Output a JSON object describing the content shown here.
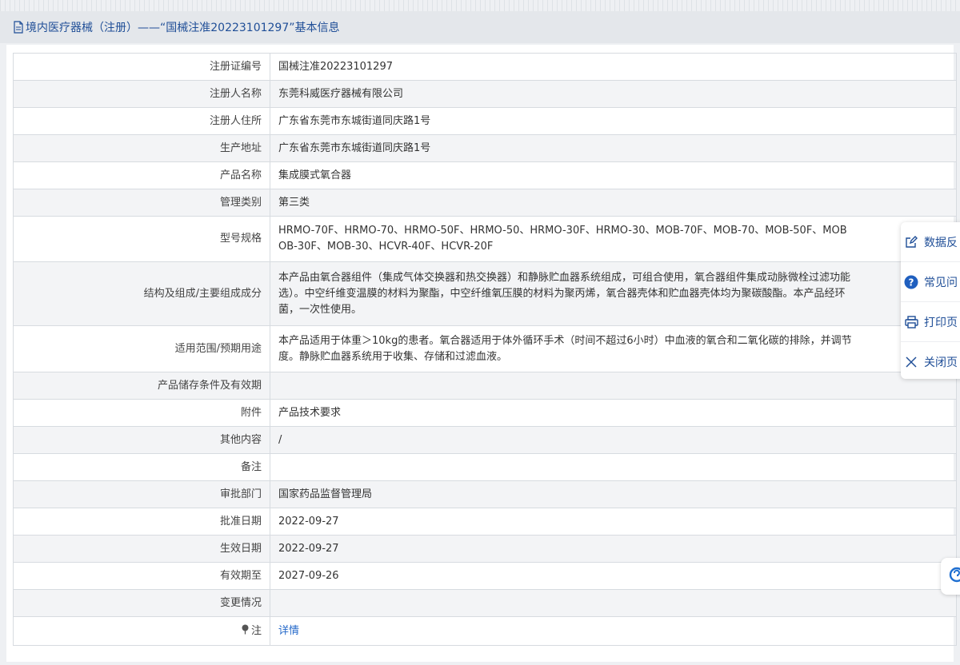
{
  "header": {
    "title": "境内医疗器械（注册）——“国械注准20223101297”基本信息"
  },
  "rows": [
    {
      "label": "注册证编号",
      "value": "国械注准20223101297"
    },
    {
      "label": "注册人名称",
      "value": "东莞科威医疗器械有限公司"
    },
    {
      "label": "注册人住所",
      "value": "广东省东莞市东城街道同庆路1号"
    },
    {
      "label": "生产地址",
      "value": "广东省东莞市东城街道同庆路1号"
    },
    {
      "label": "产品名称",
      "value": "集成膜式氧合器"
    },
    {
      "label": "管理类别",
      "value": "第三类"
    },
    {
      "label": "型号规格",
      "line1": "HRMO-70F、HRMO-70、HRMO-50F、HRMO-50、HRMO-30F、HRMO-30、MOB-70F、MOB-70、MOB-50F、MOB",
      "line2": "OB-30F、MOB-30、HCVR-40F、HCVR-20F"
    },
    {
      "label": "结构及组成/主要组成成分",
      "line1": "本产品由氧合器组件（集成气体交换器和热交换器）和静脉贮血器系统组成，可组合使用，氧合器组件集成动脉微栓过滤功能",
      "line2": "选）。中空纤维变温膜的材料为聚酯，中空纤维氧压膜的材料为聚丙烯，氧合器壳体和贮血器壳体均为聚碳酸酯。本产品经环",
      "line3": "菌，一次性使用。"
    },
    {
      "label": "适用范围/预期用途",
      "line1": "本产品适用于体重＞10kg的患者。氧合器适用于体外循环手术（时间不超过6小时）中血液的氧合和二氧化碳的排除，并调节",
      "line2": "度。静脉贮血器系统用于收集、存储和过滤血液。"
    },
    {
      "label": "产品储存条件及有效期",
      "value": ""
    },
    {
      "label": "附件",
      "value": "产品技术要求"
    },
    {
      "label": "其他内容",
      "value": "/"
    },
    {
      "label": "备注",
      "value": ""
    },
    {
      "label": "审批部门",
      "value": "国家药品监督管理局"
    },
    {
      "label": "批准日期",
      "value": "2022-09-27"
    },
    {
      "label": "生效日期",
      "value": "2022-09-27"
    },
    {
      "label": "有效期至",
      "value": "2027-09-26"
    },
    {
      "label": "变更情况",
      "value": ""
    },
    {
      "label": "注",
      "value": "详情"
    }
  ],
  "float_menu": [
    {
      "label": "数据反",
      "icon": "edit-icon"
    },
    {
      "label": "常见问",
      "icon": "help-icon"
    },
    {
      "label": "打印页",
      "icon": "print-icon"
    },
    {
      "label": "关闭页",
      "icon": "close-icon"
    }
  ],
  "colors": {
    "accent": "#1f4e97",
    "link": "#2468c9",
    "help": "#1f5fbf"
  }
}
